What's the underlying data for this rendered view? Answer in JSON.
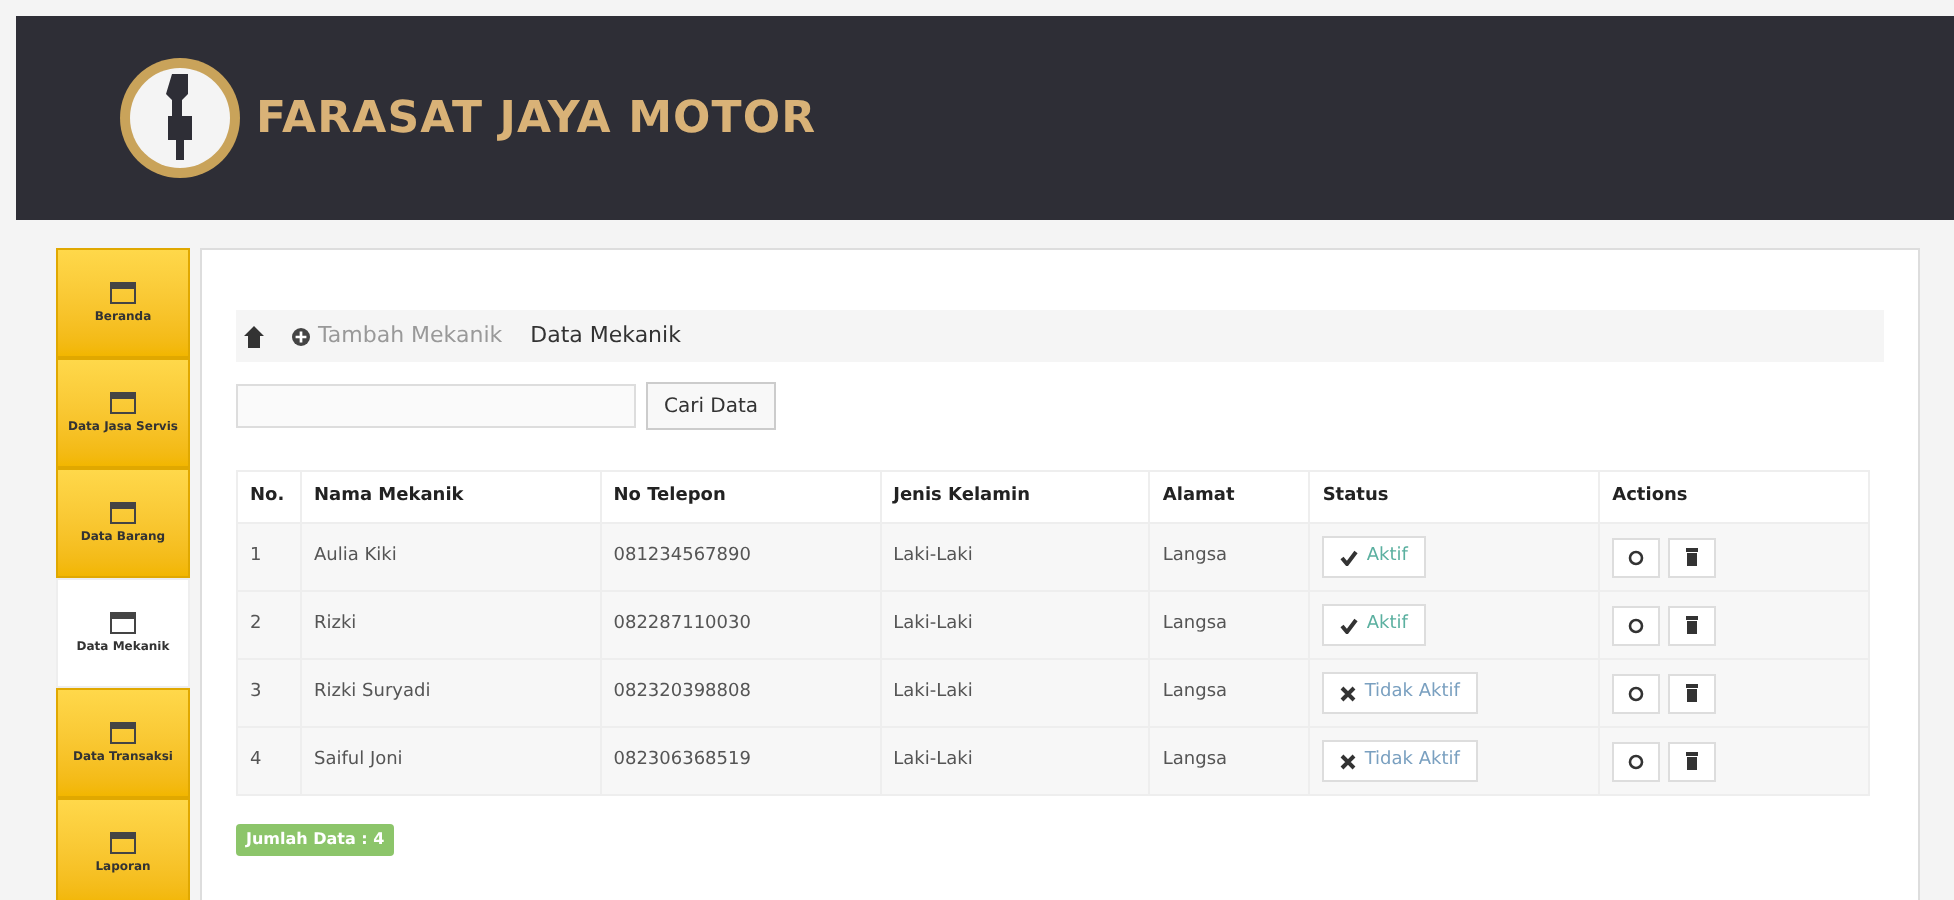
{
  "header": {
    "brand": "FARASAT JAYA MOTOR"
  },
  "sidebar": {
    "items": [
      {
        "label": "Beranda",
        "selected": false
      },
      {
        "label": "Data Jasa Servis",
        "selected": false
      },
      {
        "label": "Data Barang",
        "selected": false
      },
      {
        "label": "Data Mekanik",
        "selected": true
      },
      {
        "label": "Data Transaksi",
        "selected": false
      },
      {
        "label": "Laporan",
        "selected": false
      }
    ]
  },
  "breadcrumb": {
    "add_link": "Tambah Mekanik",
    "current": "Data Mekanik"
  },
  "search": {
    "button": "Cari Data"
  },
  "table": {
    "columns": [
      "No.",
      "Nama Mekanik",
      "No Telepon",
      "Jenis Kelamin",
      "Alamat",
      "Status",
      "Actions"
    ],
    "rows": [
      {
        "no": "1",
        "name": "Aulia Kiki",
        "phone": "081234567890",
        "gender": "Laki-Laki",
        "address": "Langsa",
        "status": "Aktif",
        "active": true
      },
      {
        "no": "2",
        "name": "Rizki",
        "phone": "082287110030",
        "gender": "Laki-Laki",
        "address": "Langsa",
        "status": "Aktif",
        "active": true
      },
      {
        "no": "3",
        "name": "Rizki Suryadi",
        "phone": "082320398808",
        "gender": "Laki-Laki",
        "address": "Langsa",
        "status": "Tidak Aktif",
        "active": false
      },
      {
        "no": "4",
        "name": "Saiful Joni",
        "phone": "082306368519",
        "gender": "Laki-Laki",
        "address": "Langsa",
        "status": "Tidak Aktif",
        "active": false
      }
    ]
  },
  "total_badge": "Jumlah Data : 4"
}
